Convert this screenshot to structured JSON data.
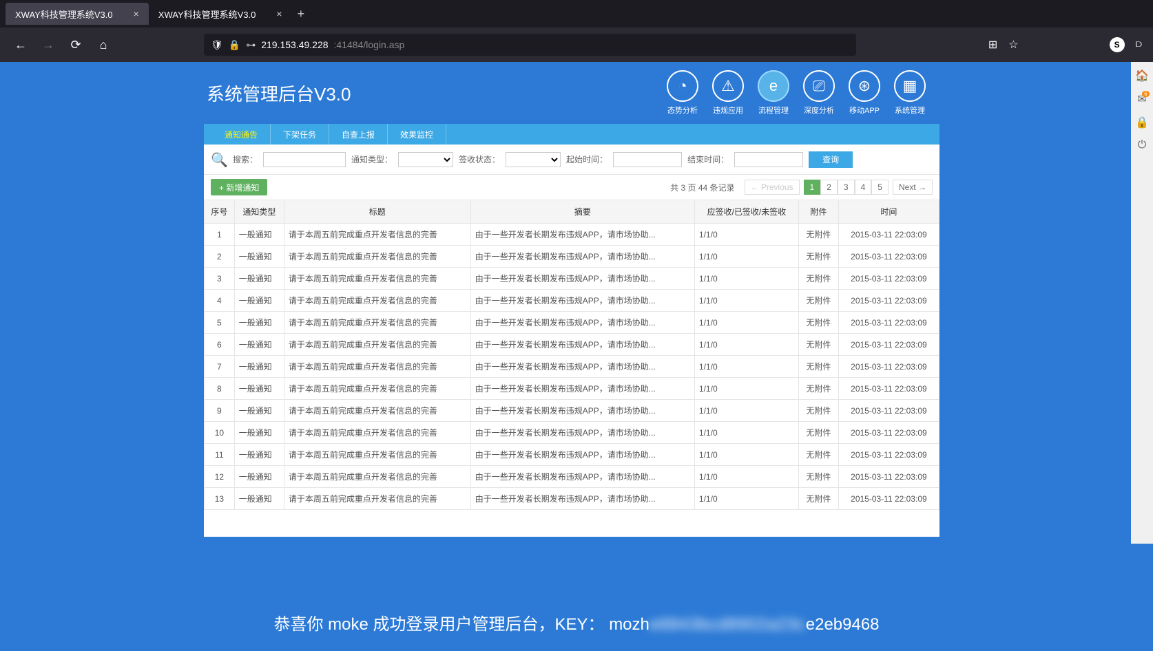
{
  "browser": {
    "tabs": [
      {
        "title": "XWAY科技管理系统V3.0",
        "active": true
      },
      {
        "title": "XWAY科技管理系统V3.0",
        "active": false
      }
    ],
    "url_host": "219.153.49.228",
    "url_rest": ":41484/login.asp",
    "avatar_letter": "S"
  },
  "header": {
    "title": "系统管理后台V3.0",
    "icons": [
      {
        "label": "态势分析",
        "glyph": "◔"
      },
      {
        "label": "违规应用",
        "glyph": "⚠"
      },
      {
        "label": "流程管理",
        "glyph": "e",
        "active": true
      },
      {
        "label": "深度分析",
        "glyph": "⎚"
      },
      {
        "label": "移动APP",
        "glyph": "⊛"
      },
      {
        "label": "系统管理",
        "glyph": "▦"
      }
    ]
  },
  "subnav": [
    {
      "label": "通知通告",
      "active": true
    },
    {
      "label": "下架任务"
    },
    {
      "label": "自查上报"
    },
    {
      "label": "效果监控"
    }
  ],
  "search": {
    "label_search": "搜索：",
    "label_type": "通知类型：",
    "label_status": "签收状态：",
    "label_start": "起始时间：",
    "label_end": "结束时间：",
    "btn_query": "查询"
  },
  "actions": {
    "btn_add": "+ 新增通知"
  },
  "pagination": {
    "info": "共 3 页 44 条记录",
    "prev": "← Previous",
    "pages": [
      "1",
      "2",
      "3",
      "4",
      "5"
    ],
    "next": "Next →",
    "active": "1"
  },
  "table": {
    "headers": [
      "序号",
      "通知类型",
      "标题",
      "摘要",
      "应签收/已签收/未签收",
      "附件",
      "时间"
    ],
    "rows": [
      {
        "idx": "1",
        "type": "一般通知",
        "title": "请于本周五前完成重点开发者信息的完善",
        "summary": "由于一些开发者长期发布违规APP，请市场协助...",
        "sign": "1/1/0",
        "attach": "无附件",
        "time": "2015-03-11 22:03:09"
      },
      {
        "idx": "2",
        "type": "一般通知",
        "title": "请于本周五前完成重点开发者信息的完善",
        "summary": "由于一些开发者长期发布违规APP，请市场协助...",
        "sign": "1/1/0",
        "attach": "无附件",
        "time": "2015-03-11 22:03:09"
      },
      {
        "idx": "3",
        "type": "一般通知",
        "title": "请于本周五前完成重点开发者信息的完善",
        "summary": "由于一些开发者长期发布违规APP，请市场协助...",
        "sign": "1/1/0",
        "attach": "无附件",
        "time": "2015-03-11 22:03:09"
      },
      {
        "idx": "4",
        "type": "一般通知",
        "title": "请于本周五前完成重点开发者信息的完善",
        "summary": "由于一些开发者长期发布违规APP，请市场协助...",
        "sign": "1/1/0",
        "attach": "无附件",
        "time": "2015-03-11 22:03:09"
      },
      {
        "idx": "5",
        "type": "一般通知",
        "title": "请于本周五前完成重点开发者信息的完善",
        "summary": "由于一些开发者长期发布违规APP，请市场协助...",
        "sign": "1/1/0",
        "attach": "无附件",
        "time": "2015-03-11 22:03:09"
      },
      {
        "idx": "6",
        "type": "一般通知",
        "title": "请于本周五前完成重点开发者信息的完善",
        "summary": "由于一些开发者长期发布违规APP，请市场协助...",
        "sign": "1/1/0",
        "attach": "无附件",
        "time": "2015-03-11 22:03:09"
      },
      {
        "idx": "7",
        "type": "一般通知",
        "title": "请于本周五前完成重点开发者信息的完善",
        "summary": "由于一些开发者长期发布违规APP，请市场协助...",
        "sign": "1/1/0",
        "attach": "无附件",
        "time": "2015-03-11 22:03:09"
      },
      {
        "idx": "8",
        "type": "一般通知",
        "title": "请于本周五前完成重点开发者信息的完善",
        "summary": "由于一些开发者长期发布违规APP，请市场协助...",
        "sign": "1/1/0",
        "attach": "无附件",
        "time": "2015-03-11 22:03:09"
      },
      {
        "idx": "9",
        "type": "一般通知",
        "title": "请于本周五前完成重点开发者信息的完善",
        "summary": "由于一些开发者长期发布违规APP，请市场协助...",
        "sign": "1/1/0",
        "attach": "无附件",
        "time": "2015-03-11 22:03:09"
      },
      {
        "idx": "10",
        "type": "一般通知",
        "title": "请于本周五前完成重点开发者信息的完善",
        "summary": "由于一些开发者长期发布违规APP，请市场协助...",
        "sign": "1/1/0",
        "attach": "无附件",
        "time": "2015-03-11 22:03:09"
      },
      {
        "idx": "11",
        "type": "一般通知",
        "title": "请于本周五前完成重点开发者信息的完善",
        "summary": "由于一些开发者长期发布违规APP，请市场协助...",
        "sign": "1/1/0",
        "attach": "无附件",
        "time": "2015-03-11 22:03:09"
      },
      {
        "idx": "12",
        "type": "一般通知",
        "title": "请于本周五前完成重点开发者信息的完善",
        "summary": "由于一些开发者长期发布违规APP，请市场协助...",
        "sign": "1/1/0",
        "attach": "无附件",
        "time": "2015-03-11 22:03:09"
      },
      {
        "idx": "13",
        "type": "一般通知",
        "title": "请于本周五前完成重点开发者信息的完善",
        "summary": "由于一些开发者长期发布违规APP，请市场协助...",
        "sign": "1/1/0",
        "attach": "无附件",
        "time": "2015-03-11 22:03:09"
      }
    ]
  },
  "right_sidebar": {
    "badge": "6"
  },
  "footer": {
    "prefix": "恭喜你 moke 成功登录用户管理后台，KEY：",
    "key_partial_start": "mozh",
    "key_blur": "e8843bcd8902a23c",
    "key_end": "e2eb9468"
  }
}
